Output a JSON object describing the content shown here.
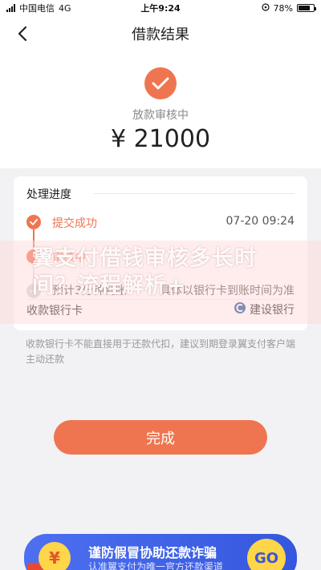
{
  "status_bar": {
    "carrier": "中国电信",
    "network": "4G",
    "time": "上午9:24",
    "battery_percent": "78%",
    "battery_level": 0.78
  },
  "nav": {
    "title": "借款结果",
    "back_icon": "chevron-left-icon"
  },
  "result": {
    "icon": "check-icon",
    "status": "放款审核中",
    "amount": "¥ 21000",
    "accent_color": "#ef7550"
  },
  "progress": {
    "title": "处理进度",
    "steps": [
      {
        "label": "提交成功",
        "time": "07-20 09:24",
        "state": "done"
      },
      {
        "label": "审核中",
        "time": "",
        "state": "active"
      },
      {
        "label": "预计3分钟到账",
        "time": "具体以银行卡到账时间为准",
        "state": "pending"
      }
    ]
  },
  "bank": {
    "label": "收款银行卡",
    "value": "建设银行",
    "icon": "ccb-bank-icon"
  },
  "watermark": "翼支付借钱审核多长时间？流程解析+",
  "note": "收款银行卡不能直接用于还款代扣，建议到期登录翼支付客户端主动还款",
  "done_button": "完成",
  "banner": {
    "title": "谨防假冒协助还款诈骗",
    "subtitle": "认准翼支付为唯一官方还款渠道",
    "coin_symbol": "¥",
    "go_label": "GO"
  }
}
